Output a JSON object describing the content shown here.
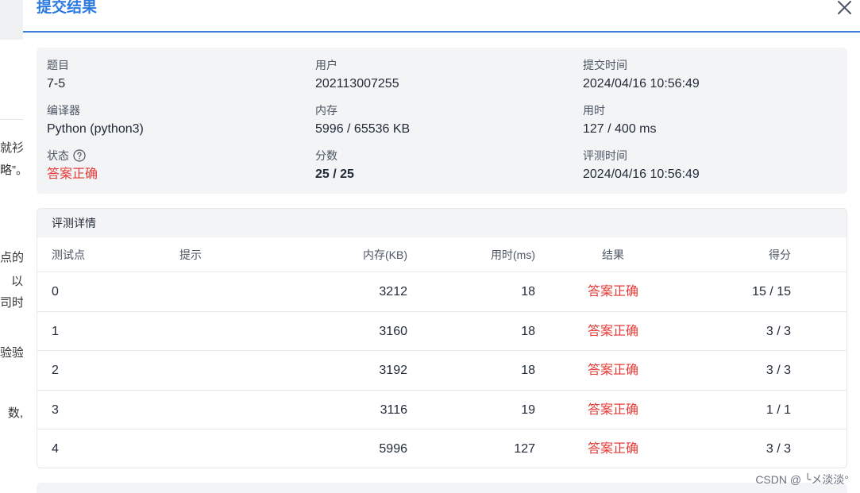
{
  "background": {
    "fragments": [
      "就衫",
      "略”。",
      "点的",
      "以",
      "司时",
      "验验",
      "数,"
    ]
  },
  "modal": {
    "title": "提交结果",
    "summary": {
      "problem_label": "题目",
      "problem_value": "7-5",
      "user_label": "用户",
      "user_value": "202113007255",
      "submit_time_label": "提交时间",
      "submit_time_value": "2024/04/16 10:56:49",
      "compiler_label": "编译器",
      "compiler_value": "Python (python3)",
      "memory_label": "内存",
      "memory_value": "5996 / 65536 KB",
      "time_label": "用时",
      "time_value": "127 / 400 ms",
      "status_label": "状态",
      "status_value": "答案正确",
      "score_label": "分数",
      "score_value": "25 / 25",
      "judge_time_label": "评测时间",
      "judge_time_value": "2024/04/16 10:56:49"
    },
    "detail": {
      "title": "评测详情",
      "columns": {
        "case": "测试点",
        "hint": "提示",
        "memory": "内存(KB)",
        "time": "用时(ms)",
        "result": "结果",
        "score": "得分"
      },
      "rows": [
        {
          "case": "0",
          "hint": "",
          "memory": "3212",
          "time": "18",
          "result": "答案正确",
          "score": "15 / 15"
        },
        {
          "case": "1",
          "hint": "",
          "memory": "3160",
          "time": "18",
          "result": "答案正确",
          "score": "3 / 3"
        },
        {
          "case": "2",
          "hint": "",
          "memory": "3192",
          "time": "18",
          "result": "答案正确",
          "score": "3 / 3"
        },
        {
          "case": "3",
          "hint": "",
          "memory": "3116",
          "time": "19",
          "result": "答案正确",
          "score": "1 / 1"
        },
        {
          "case": "4",
          "hint": "",
          "memory": "5996",
          "time": "127",
          "result": "答案正确",
          "score": "3 / 3"
        }
      ]
    }
  },
  "watermark": "CSDN @ ╰メ淡淡°",
  "colors": {
    "accent": "#2d7be0",
    "success_red": "#e53935",
    "panel_bg": "#f3f4f6"
  }
}
